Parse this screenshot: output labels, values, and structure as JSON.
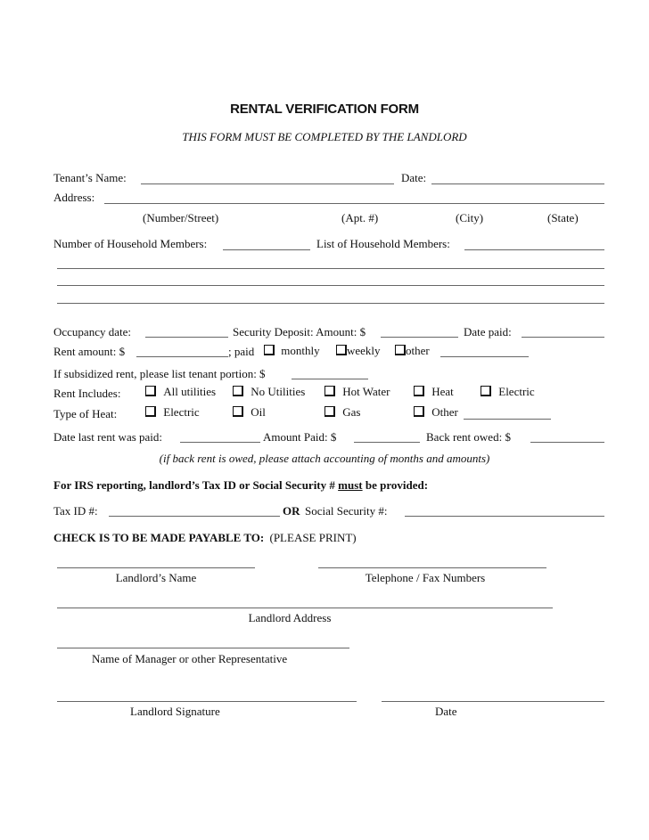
{
  "header": {
    "title": "RENTAL VERIFICATION FORM",
    "subtitle": "THIS FORM MUST BE COMPLETED BY THE LANDLORD"
  },
  "tenant": {
    "name_label": "Tenant’s Name:",
    "date_label": "Date:",
    "address_label": "Address:",
    "address_parts": [
      "(Number/Street)",
      "(Apt. #)",
      "(City)",
      "(State)"
    ],
    "household_count_label": "Number of Household Members:",
    "household_list_label": "List of Household Members:"
  },
  "occupancy": {
    "occupancy_date_label": "Occupancy date:",
    "security_deposit_label": "Security Deposit: Amount: $",
    "date_paid_label": "Date paid:",
    "rent_amount_label": "Rent amount: $",
    "paid_label": "; paid",
    "frequency_options": [
      "monthly",
      "weekly",
      "other"
    ],
    "subsidized_label": "If subsidized rent, please list tenant portion: $"
  },
  "rent_includes": {
    "label": "Rent Includes:",
    "options": [
      "All utilities",
      "No Utilities",
      "Hot Water",
      "Heat",
      "Electric"
    ]
  },
  "heat_type": {
    "label": "Type of Heat:",
    "options": [
      "Electric",
      "Oil",
      "Gas",
      "Other"
    ]
  },
  "payment": {
    "last_paid_label": "Date last rent was paid:",
    "amount_paid_label": "Amount Paid: $",
    "back_rent_label": "Back rent owed: $",
    "note": "(if back rent is owed, please attach accounting of months and amounts)"
  },
  "irs": {
    "heading_pre": "For IRS reporting, landlord’s Tax ID or Social Security #",
    "heading_emph": "must",
    "heading_post": "be provided:",
    "tax_id_label": "Tax ID #:",
    "or_label": "OR",
    "ssn_label": "Social Security #:"
  },
  "payee": {
    "heading": "CHECK IS TO BE MADE PAYABLE TO:",
    "heading_note": "(PLEASE PRINT)",
    "landlord_name": "Landlord’s Name",
    "phone_fax": "Telephone / Fax Numbers",
    "landlord_address": "Landlord Address",
    "manager_name": "Name of Manager or other Representative",
    "signature": "Landlord Signature",
    "date": "Date"
  }
}
